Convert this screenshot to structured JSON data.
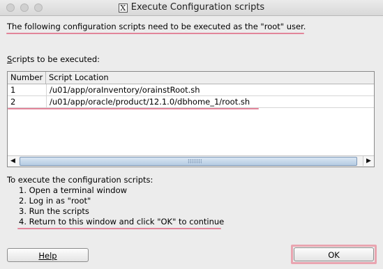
{
  "window": {
    "title": "Execute Configuration scripts",
    "title_icon": "X"
  },
  "intro": "The following configuration scripts need to be executed as the \"root\" user.",
  "scripts_label": {
    "mnemonic": "S",
    "rest": "cripts to be executed:"
  },
  "table": {
    "columns": [
      "Number",
      "Script Location"
    ],
    "rows": [
      {
        "number": "1",
        "location": "/u01/app/oraInventory/orainstRoot.sh"
      },
      {
        "number": "2",
        "location": "/u01/app/oracle/product/12.1.0/dbhome_1/root.sh"
      }
    ]
  },
  "instructions": {
    "heading": "To execute the configuration scripts:",
    "steps": [
      "1. Open a terminal window",
      "2. Log in as \"root\"",
      "3. Run the scripts",
      "4. Return to this window and click \"OK\" to continue"
    ]
  },
  "buttons": {
    "help": "Help",
    "ok": "OK"
  },
  "colors": {
    "annotation": "#e2859a"
  }
}
